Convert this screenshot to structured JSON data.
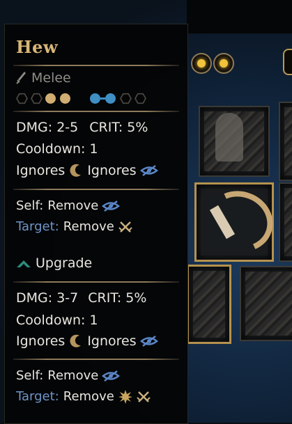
{
  "tooltip": {
    "title": "Hew",
    "range": "Melee",
    "stats": {
      "dmg": "DMG: 2-5",
      "crit": "CRIT: 5%",
      "cooldown": "Cooldown: 1",
      "ignores_a": "Ignores",
      "ignores_b": "Ignores"
    },
    "effects": {
      "self_label": "Self:",
      "self_value": "Remove",
      "target_label": "Target:",
      "target_value": "Remove"
    },
    "upgrade_label": "Upgrade",
    "upgrade_stats": {
      "dmg": "DMG: 3-7",
      "crit": "CRIT: 5%",
      "cooldown": "Cooldown: 1",
      "ignores_a": "Ignores",
      "ignores_b": "Ignores"
    },
    "upgrade_effects": {
      "self_label": "Self:",
      "self_value": "Remove",
      "target_label": "Target:",
      "target_value": "Remove"
    }
  },
  "icons": {
    "dagger": "dagger-icon",
    "moon": "crescent-moon-icon",
    "stealth": "stealth-eye-icon",
    "cross_swords": "crossed-swords-icon",
    "upgrade": "upgrade-arrow-icon",
    "burst": "burst-star-icon"
  },
  "colors": {
    "title": "#d9b677",
    "target_label": "#6f95c9",
    "position_tan": "#d0ad72",
    "position_blue": "#3f8ec4",
    "upgrade_teal": "#2e8a7b"
  }
}
